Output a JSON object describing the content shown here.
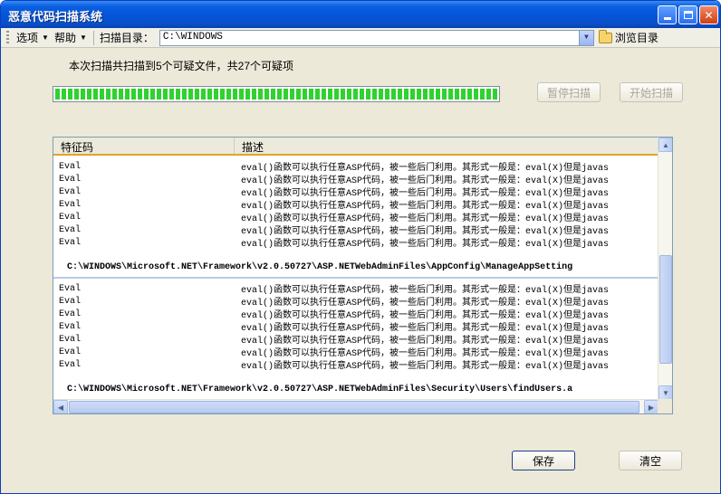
{
  "window": {
    "title": "恶意代码扫描系统"
  },
  "toolbar": {
    "options_label": "选项",
    "help_label": "帮助",
    "scan_dir_label": "扫描目录：",
    "scan_dir_value": "C:\\WINDOWS",
    "browse_label": "浏览目录"
  },
  "status": {
    "summary": "本次扫描共扫描到5个可疑文件，共27个可疑项",
    "progress_percent": 100
  },
  "buttons": {
    "pause": "暂停扫描",
    "start": "开始扫描",
    "save": "保存",
    "clear": "清空"
  },
  "list": {
    "columns": [
      "特征码",
      "描述"
    ],
    "groups": [
      {
        "rows": [
          {
            "sig": "Eval",
            "desc": "eval()函数可以执行任意ASP代码，被一些后门利用。其形式一般是：eval(X)但是javas"
          },
          {
            "sig": "Eval",
            "desc": "eval()函数可以执行任意ASP代码，被一些后门利用。其形式一般是：eval(X)但是javas"
          },
          {
            "sig": "Eval",
            "desc": "eval()函数可以执行任意ASP代码，被一些后门利用。其形式一般是：eval(X)但是javas"
          },
          {
            "sig": "Eval",
            "desc": "eval()函数可以执行任意ASP代码，被一些后门利用。其形式一般是：eval(X)但是javas"
          },
          {
            "sig": "Eval",
            "desc": "eval()函数可以执行任意ASP代码，被一些后门利用。其形式一般是：eval(X)但是javas"
          },
          {
            "sig": "Eval",
            "desc": "eval()函数可以执行任意ASP代码，被一些后门利用。其形式一般是：eval(X)但是javas"
          },
          {
            "sig": "Eval",
            "desc": "eval()函数可以执行任意ASP代码，被一些后门利用。其形式一般是：eval(X)但是javas"
          }
        ],
        "path": "C:\\WINDOWS\\Microsoft.NET\\Framework\\v2.0.50727\\ASP.NETWebAdminFiles\\AppConfig\\ManageAppSetting"
      },
      {
        "rows": [
          {
            "sig": "Eval",
            "desc": "eval()函数可以执行任意ASP代码，被一些后门利用。其形式一般是：eval(X)但是javas"
          },
          {
            "sig": "Eval",
            "desc": "eval()函数可以执行任意ASP代码，被一些后门利用。其形式一般是：eval(X)但是javas"
          },
          {
            "sig": "Eval",
            "desc": "eval()函数可以执行任意ASP代码，被一些后门利用。其形式一般是：eval(X)但是javas"
          },
          {
            "sig": "Eval",
            "desc": "eval()函数可以执行任意ASP代码，被一些后门利用。其形式一般是：eval(X)但是javas"
          },
          {
            "sig": "Eval",
            "desc": "eval()函数可以执行任意ASP代码，被一些后门利用。其形式一般是：eval(X)但是javas"
          },
          {
            "sig": "Eval",
            "desc": "eval()函数可以执行任意ASP代码，被一些后门利用。其形式一般是：eval(X)但是javas"
          },
          {
            "sig": "Eval",
            "desc": "eval()函数可以执行任意ASP代码，被一些后门利用。其形式一般是：eval(X)但是javas"
          }
        ],
        "path": "C:\\WINDOWS\\Microsoft.NET\\Framework\\v2.0.50727\\ASP.NETWebAdminFiles\\Security\\Users\\findUsers.a"
      }
    ]
  },
  "icons": {
    "minimize": "minimize-icon",
    "maximize": "maximize-icon",
    "close": "close-icon",
    "folder": "folder-icon",
    "dropdown": "chevron-down-icon"
  },
  "colors": {
    "titlebar": "#0554d8",
    "progress": "#2fd22f",
    "header_accent": "#e0a528"
  }
}
